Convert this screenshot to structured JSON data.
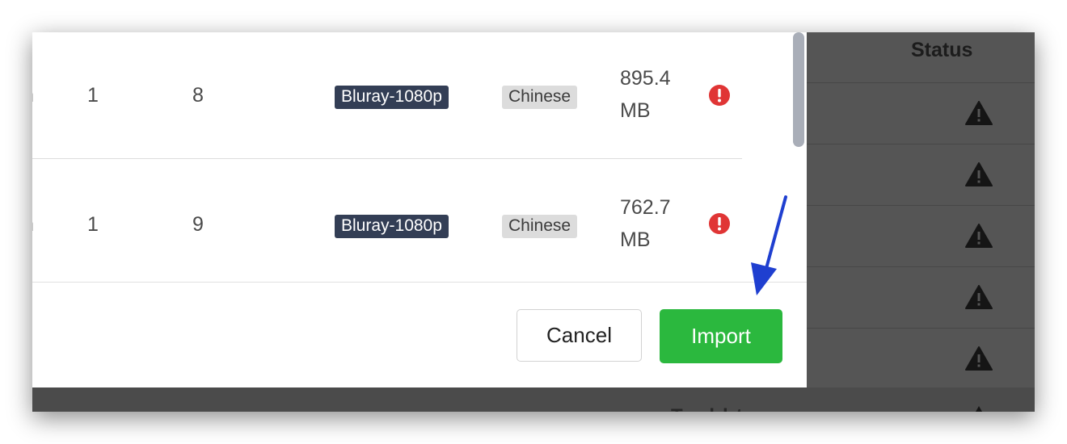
{
  "background_table": {
    "status_header": "Status",
    "row_icon": "warning-icon",
    "row_count": 5,
    "bottom_text": "Tvshbt"
  },
  "rows": [
    {
      "name": "n",
      "season": "1",
      "episode": "8",
      "quality": "Bluray-1080p",
      "language": "Chinese",
      "size_line1": "895.4",
      "size_line2": "MB",
      "status_icon": "error-icon"
    },
    {
      "name": "n",
      "season": "1",
      "episode": "9",
      "quality": "Bluray-1080p",
      "language": "Chinese",
      "size_line1": "762.7",
      "size_line2": "MB",
      "status_icon": "error-icon"
    }
  ],
  "footer": {
    "cancel_label": "Cancel",
    "import_label": "Import"
  },
  "colors": {
    "import_button": "#2bb83e",
    "quality_badge": "#333e55",
    "error_icon": "#e03535",
    "annotation_arrow": "#1f3fd0",
    "overlay": "#555555"
  }
}
